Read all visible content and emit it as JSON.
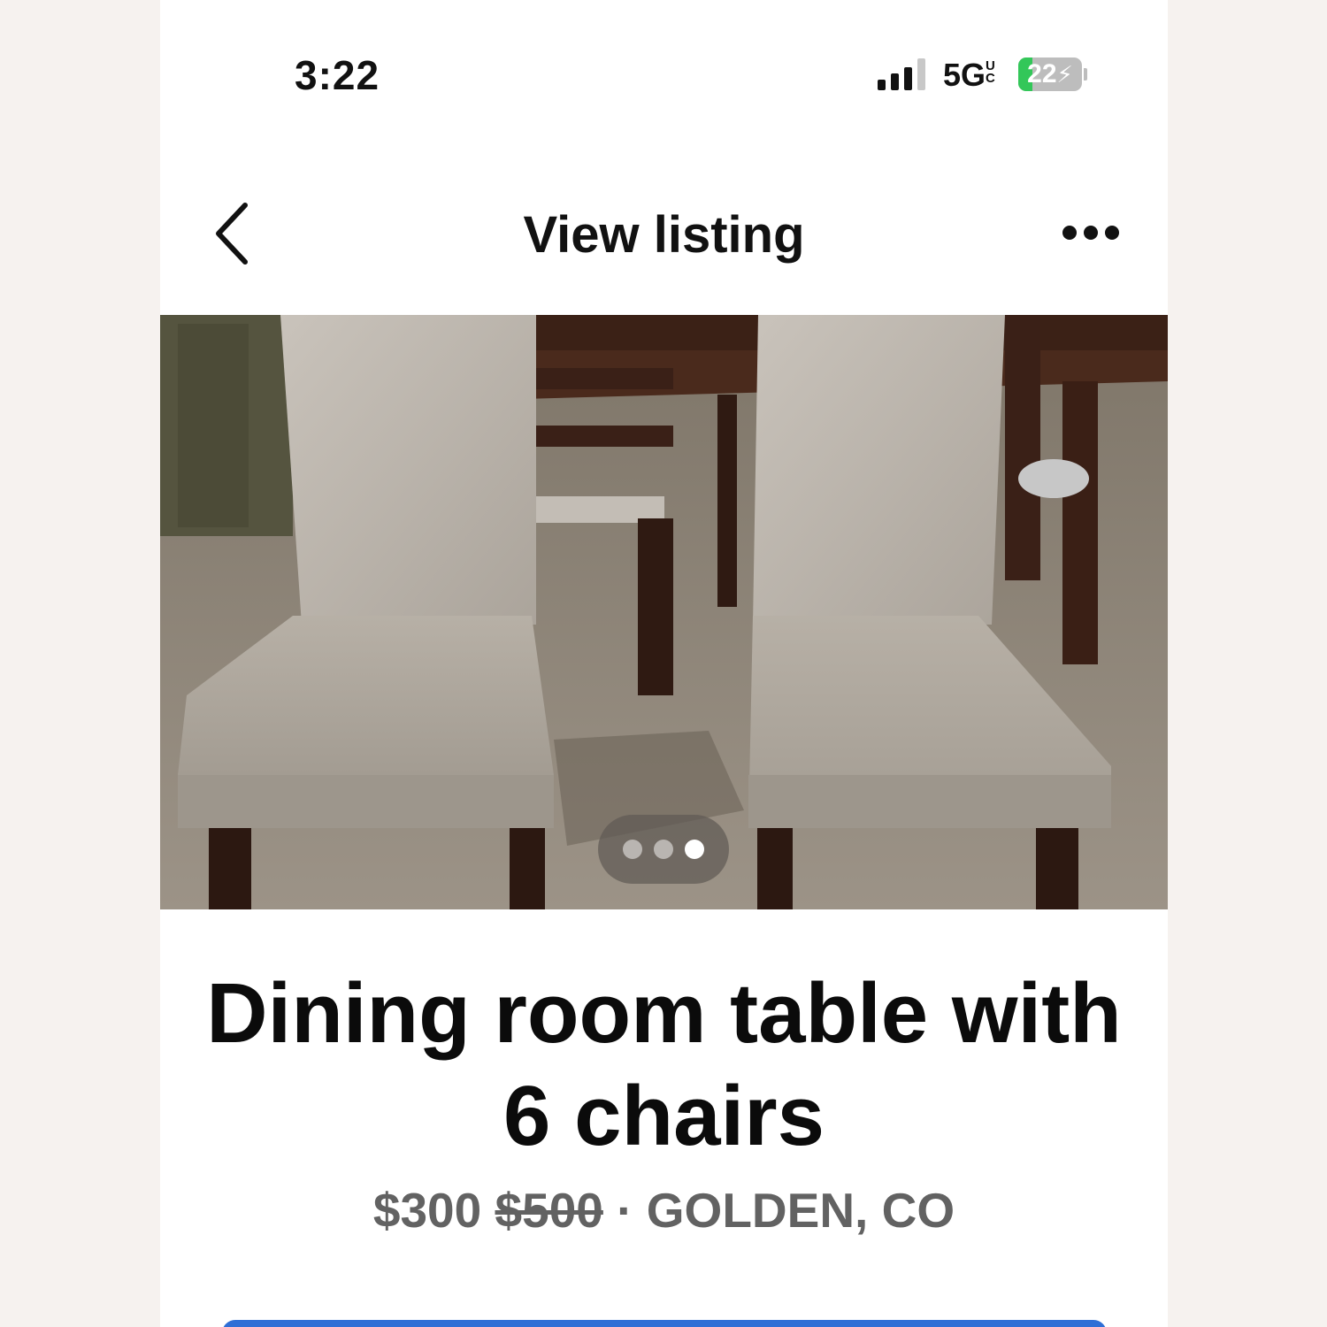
{
  "status_bar": {
    "time": "3:22",
    "network": "5G",
    "network_suffix": "UC",
    "battery_percent": 22,
    "battery_label": "22",
    "charging": true,
    "signal_bars_active": 3,
    "signal_bars_total": 4
  },
  "nav": {
    "title": "View listing",
    "back_icon": "chevron-left-icon",
    "more_icon": "more-horizontal-icon"
  },
  "photo": {
    "page_count": 3,
    "active_page": 3
  },
  "listing": {
    "title": "Dining room table with 6 chairs",
    "price": "$300",
    "original_price": "$500",
    "separator": "·",
    "location": "GOLDEN, CO"
  },
  "colors": {
    "primary_text": "#0b0b0b",
    "secondary_text": "#626262",
    "battery_green": "#33c759",
    "accent_blue": "#2f6fd6"
  }
}
